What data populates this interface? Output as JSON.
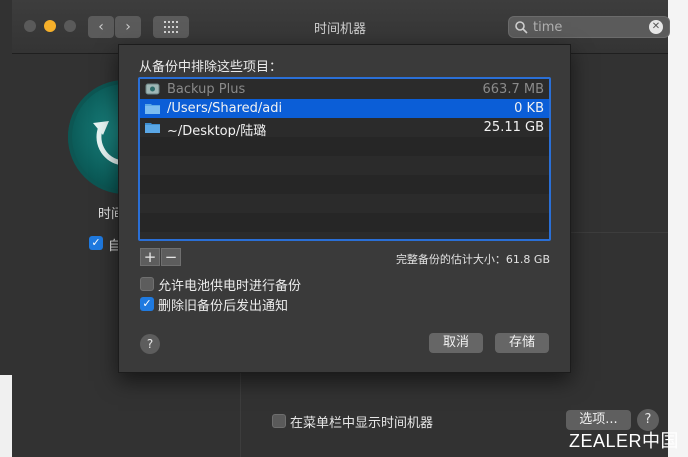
{
  "window": {
    "title": "时间机器",
    "search": {
      "value": "time"
    },
    "nav": {
      "back_icon": "chevron-left-icon",
      "forward_icon": "chevron-right-icon",
      "grid_icon": "grid-icon"
    }
  },
  "background": {
    "app_label": "时间",
    "auto_backup_label": "自",
    "show_menubar_label": "在菜单栏中显示时间机器",
    "options_button": "选项...",
    "help_label": "?",
    "watermark": "ZEALER中国"
  },
  "sheet": {
    "title": "从备份中排除这些项目：",
    "items": [
      {
        "name": "Backup Plus",
        "size": "663.7 MB",
        "icon": "drive-icon",
        "state": "dim"
      },
      {
        "name": "/Users/Shared/adi",
        "size": "0 KB",
        "icon": "folder-icon",
        "state": "selected"
      },
      {
        "name": "~/Desktop/陆璐",
        "size": "25.11 GB",
        "icon": "folder-icon",
        "state": "normal"
      }
    ],
    "add_label": "+",
    "remove_label": "−",
    "estimate_text": "完整备份的估计大小：61.8 GB",
    "options": [
      {
        "label": "允许电池供电时进行备份",
        "checked": false
      },
      {
        "label": "删除旧备份后发出通知",
        "checked": true
      }
    ],
    "help_label": "?",
    "cancel_label": "取消",
    "save_label": "存储"
  },
  "colors": {
    "accent": "#0b5ed7",
    "focus_ring": "#2a6fd6",
    "traffic_yellow": "#f6b02a"
  }
}
